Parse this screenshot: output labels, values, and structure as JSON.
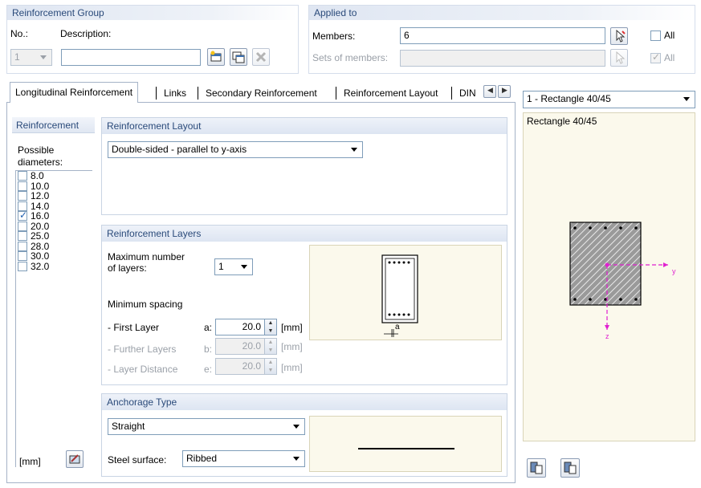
{
  "reinforcement_group": {
    "title": "Reinforcement Group",
    "no_label": "No.:",
    "no_value": "1",
    "description_label": "Description:",
    "description_value": ""
  },
  "applied_to": {
    "title": "Applied to",
    "members_label": "Members:",
    "members_value": "6",
    "sets_label": "Sets of members:",
    "sets_value": "",
    "all_label": "All",
    "all_label_2": "All"
  },
  "tabs": [
    {
      "label": "Longitudinal Reinforcement"
    },
    {
      "label": "Links"
    },
    {
      "label": "Secondary Reinforcement"
    },
    {
      "label": "Reinforcement Layout"
    },
    {
      "label": "DIN"
    }
  ],
  "reinforcement": {
    "title": "Reinforcement",
    "possible_label": "Possible diameters:",
    "unit": "[mm]",
    "diameters": [
      {
        "label": "8.0",
        "checked": false
      },
      {
        "label": "10.0",
        "checked": false
      },
      {
        "label": "12.0",
        "checked": false
      },
      {
        "label": "14.0",
        "checked": false
      },
      {
        "label": "16.0",
        "checked": true
      },
      {
        "label": "20.0",
        "checked": false
      },
      {
        "label": "25.0",
        "checked": false
      },
      {
        "label": "28.0",
        "checked": false
      },
      {
        "label": "30.0",
        "checked": false
      },
      {
        "label": "32.0",
        "checked": false
      }
    ]
  },
  "layout": {
    "title": "Reinforcement Layout",
    "selected": "Double-sided - parallel to y-axis"
  },
  "layers": {
    "title": "Reinforcement Layers",
    "max_label_1": "Maximum number",
    "max_label_2": "of layers:",
    "max_value": "1",
    "min_spacing_label": "Minimum spacing",
    "first_label": "- First Layer",
    "first_key": "a:",
    "first_value": "20.0",
    "further_label": "- Further Layers",
    "further_key": "b:",
    "further_value": "20.0",
    "distance_label": "- Layer Distance",
    "distance_key": "e:",
    "distance_value": "20.0",
    "unit": "[mm]",
    "preview_label": "a"
  },
  "anchorage": {
    "title": "Anchorage Type",
    "type_value": "Straight",
    "steel_label": "Steel surface:",
    "steel_value": "Ribbed"
  },
  "section": {
    "selected": "1 - Rectangle 40/45",
    "preview_title": "Rectangle 40/45",
    "axis_y": "y",
    "axis_z": "z"
  },
  "colors": {
    "header_blue": "#2a4a7a",
    "axis_magenta": "#e020d0",
    "preview_bg": "#fbf9ec"
  }
}
